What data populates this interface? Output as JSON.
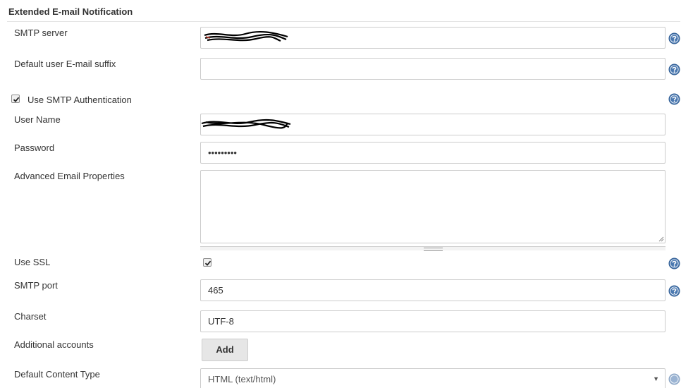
{
  "section": {
    "title": "Extended E-mail Notification"
  },
  "fields": {
    "smtp_server": {
      "label": "SMTP server",
      "value": ""
    },
    "email_suffix": {
      "label": "Default user E-mail suffix",
      "value": ""
    },
    "use_smtp_auth": {
      "label": "Use SMTP Authentication",
      "checked": true
    },
    "user_name": {
      "label": "User Name",
      "value": ""
    },
    "password": {
      "label": "Password",
      "value": "•••••••••"
    },
    "advanced_props": {
      "label": "Advanced Email Properties",
      "value": ""
    },
    "use_ssl": {
      "label": "Use SSL",
      "checked": true
    },
    "smtp_port": {
      "label": "SMTP port",
      "value": "465"
    },
    "charset": {
      "label": "Charset",
      "value": "UTF-8"
    },
    "additional_accounts": {
      "label": "Additional accounts",
      "button_label": "Add"
    },
    "default_content_type": {
      "label": "Default Content Type",
      "value": "HTML (text/html)"
    }
  },
  "icons": {
    "help": "help-icon",
    "check": "check-icon",
    "dropdown": "chevron-down-icon"
  },
  "colors": {
    "help_icon": "#4a78b0",
    "border": "#cccccc",
    "button_bg": "#e6e6e6"
  }
}
